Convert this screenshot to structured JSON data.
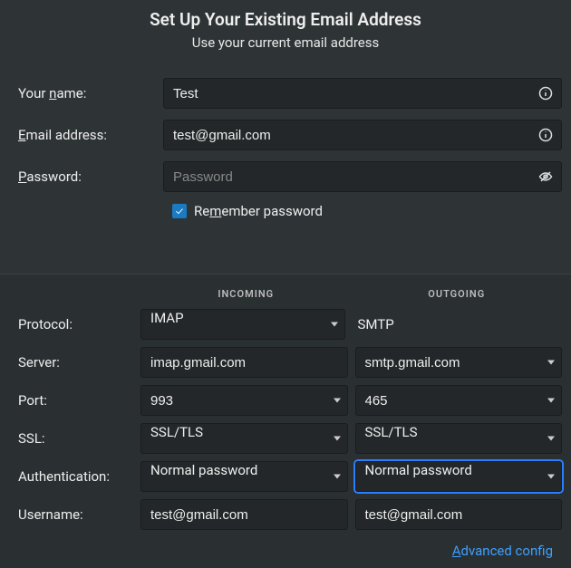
{
  "header": {
    "title": "Set Up Your Existing Email Address",
    "subtitle": "Use your current email address"
  },
  "form": {
    "name_label_pre": "Your ",
    "name_label_u": "n",
    "name_label_post": "ame:",
    "name_value": "Test",
    "email_label_u": "E",
    "email_label_post": "mail address:",
    "email_value": "test@gmail.com",
    "pass_label_u": "P",
    "pass_label_post": "assword:",
    "pass_placeholder": "Password",
    "remember_pre": "Re",
    "remember_u": "m",
    "remember_post": "ember password"
  },
  "cols": {
    "incoming": "INCOMING",
    "outgoing": "OUTGOING"
  },
  "rows": {
    "protocol": "Protocol:",
    "server": "Server:",
    "port": "Port:",
    "ssl": "SSL:",
    "auth": "Authentication:",
    "username": "Username:"
  },
  "incoming": {
    "protocol": "IMAP",
    "server": "imap.gmail.com",
    "port": "993",
    "ssl": "SSL/TLS",
    "auth": "Normal password",
    "username": "test@gmail.com"
  },
  "outgoing": {
    "protocol": "SMTP",
    "server": "smtp.gmail.com",
    "port": "465",
    "ssl": "SSL/TLS",
    "auth": "Normal password",
    "username": "test@gmail.com"
  },
  "advanced_u": "A",
  "advanced_post": "dvanced config"
}
